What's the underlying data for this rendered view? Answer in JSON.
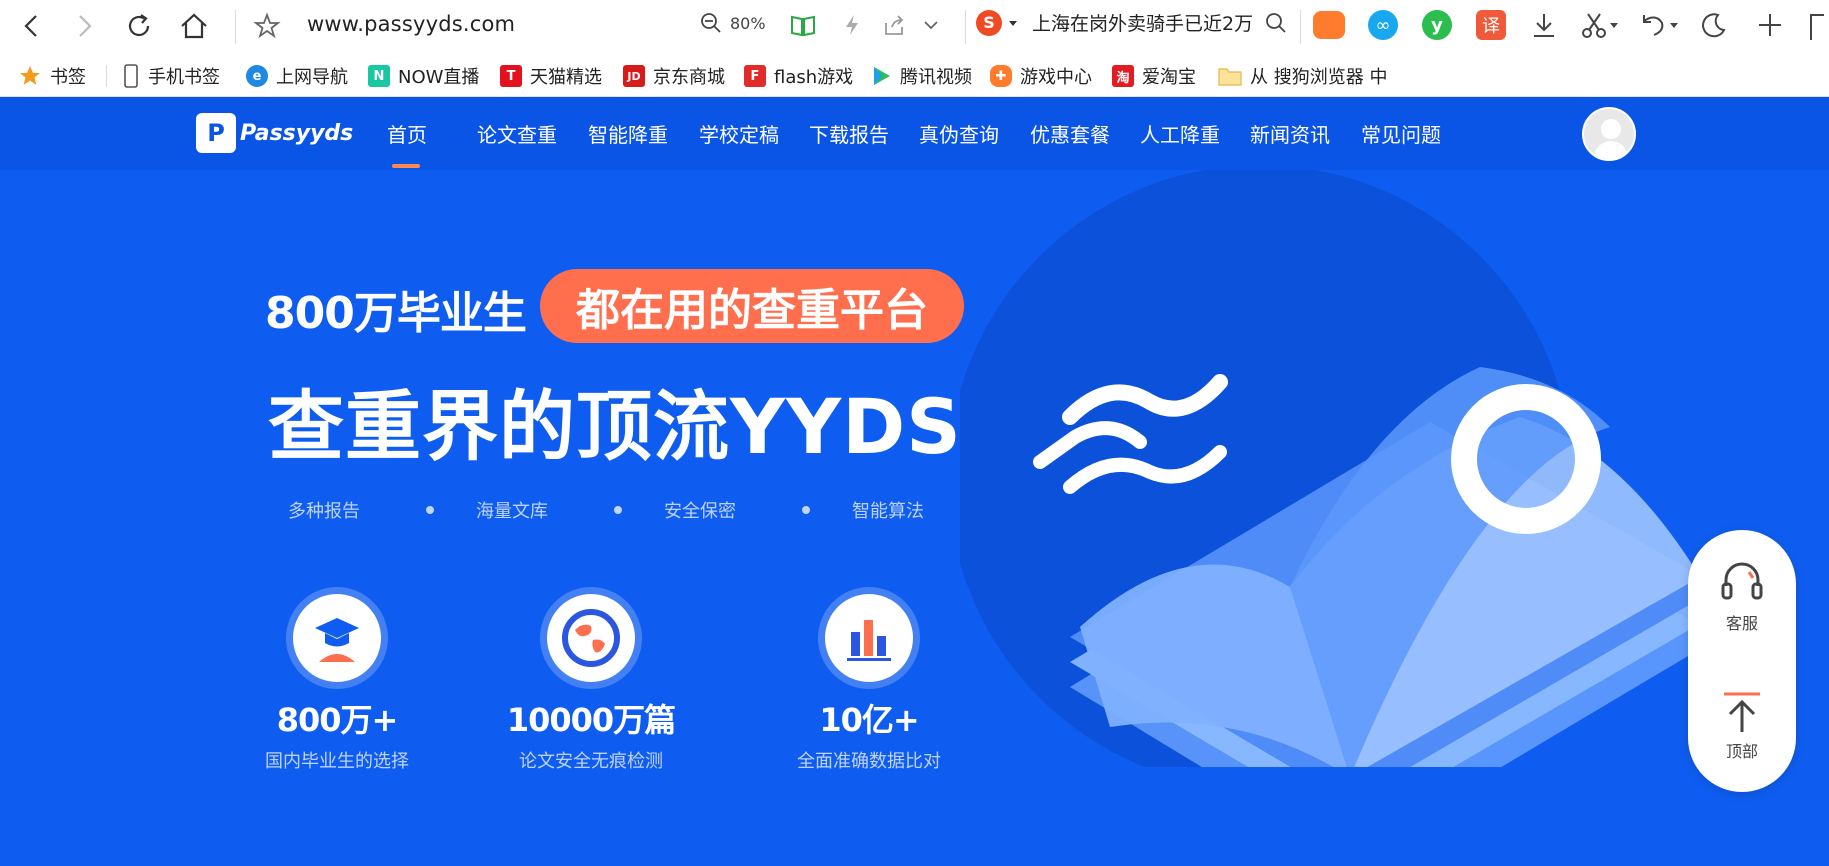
{
  "browser": {
    "url": "www.passyyds.com",
    "zoom": "80%",
    "search_text": "上海在岗外卖骑手已近2万",
    "bookmarks": [
      {
        "label": "书签",
        "icon": "star-icon"
      },
      {
        "label": "手机书签",
        "icon": "phone-icon"
      },
      {
        "label": "上网导航",
        "icon": "ie-icon"
      },
      {
        "label": "NOW直播",
        "icon": "now-icon"
      },
      {
        "label": "天猫精选",
        "icon": "tmall-icon"
      },
      {
        "label": "京东商城",
        "icon": "jd-icon"
      },
      {
        "label": "flash游戏",
        "icon": "flash-icon"
      },
      {
        "label": "腾讯视频",
        "icon": "play-icon"
      },
      {
        "label": "游戏中心",
        "icon": "gamepad-icon"
      },
      {
        "label": "爱淘宝",
        "icon": "taobao-icon"
      },
      {
        "label": "从 搜狗浏览器 中",
        "icon": "folder-icon"
      }
    ]
  },
  "site": {
    "logo_text": "Passyyds",
    "logo_mark": "P",
    "nav": [
      "首页",
      "论文查重",
      "智能降重",
      "学校定稿",
      "下载报告",
      "真伪查询",
      "优惠套餐",
      "人工降重",
      "新闻资讯",
      "常见问题"
    ],
    "hero": {
      "line1": "800万毕业生",
      "pill": "都在用的查重平台",
      "title": "查重界的顶流YYDS",
      "features": [
        "多种报告",
        "海量文库",
        "安全保密",
        "智能算法"
      ]
    },
    "stats": [
      {
        "value": "800万+",
        "label": "国内毕业生的选择",
        "icon": "graduation-cap-icon"
      },
      {
        "value": "10000万篇",
        "label": "论文安全无痕检测",
        "icon": "globe-icon"
      },
      {
        "value": "10亿+",
        "label": "全面准确数据比对",
        "icon": "bar-chart-icon"
      }
    ],
    "side_widget": {
      "service": "客服",
      "top": "顶部"
    },
    "colors": {
      "primary": "#0f5df0",
      "accent": "#ff6f4e"
    }
  }
}
